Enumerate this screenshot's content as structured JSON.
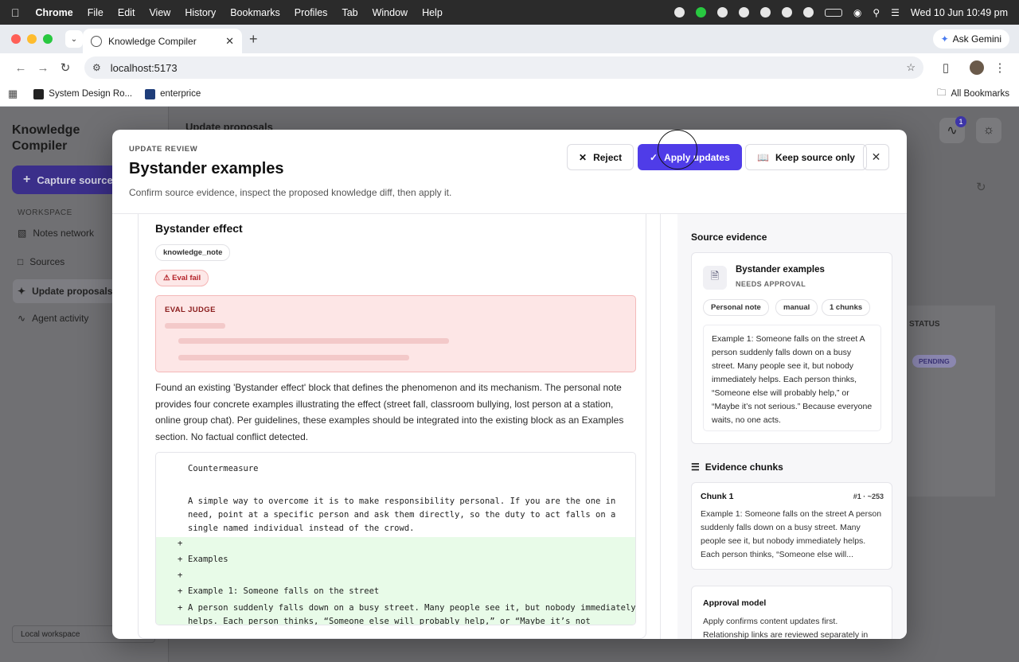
{
  "menubar": {
    "app": "Chrome",
    "items": [
      "File",
      "Edit",
      "View",
      "History",
      "Bookmarks",
      "Profiles",
      "Tab",
      "Window",
      "Help"
    ],
    "datetime": "Wed 10 Jun  10:49 pm"
  },
  "browser": {
    "tab_title": "Knowledge Compiler",
    "url": "localhost:5173",
    "ask_gemini": "Ask Gemini",
    "bookmarks": [
      "System Design Ro...",
      "enterprice"
    ],
    "all_bookmarks": "All Bookmarks"
  },
  "sidebar": {
    "brand": "Knowledge Compiler",
    "capture_button": "Capture source",
    "section_label": "WORKSPACE",
    "items": [
      "Notes network",
      "Sources",
      "Update proposals",
      "Agent activity"
    ],
    "active": "Update proposals",
    "footer": "Local workspace"
  },
  "background": {
    "page_title": "Update proposals",
    "status_header": "STATUS",
    "status_value": "PENDING",
    "activity_badge": "1"
  },
  "modal": {
    "eyebrow": "UPDATE REVIEW",
    "title": "Bystander examples",
    "subtitle": "Confirm source evidence, inspect the proposed knowledge diff, then apply it.",
    "reject": "Reject",
    "apply": "Apply updates",
    "keep_source": "Keep source only",
    "block": {
      "title": "Bystander effect",
      "type": "knowledge_note",
      "eval_status": "Eval fail",
      "eval_heading": "EVAL JUDGE",
      "rationale": "Found an existing 'Bystander effect' block that defines the phenomenon and its mechanism. The personal note provides four concrete examples illustrating the effect (street fall, classroom bullying, lost person at a station, online group chat). Per guidelines, these examples should be integrated into the existing block as an Examples section. No factual conflict detected."
    },
    "diff": [
      {
        "sign": "",
        "text": "Countermeasure"
      },
      {
        "sign": "",
        "text": ""
      },
      {
        "sign": "",
        "text": "A simple way to overcome it is to make responsibility personal. If you are the one in"
      },
      {
        "sign": "",
        "text": "need, point at a specific person and ask them directly, so the duty to act falls on a"
      },
      {
        "sign": "",
        "text": "single named individual instead of the crowd."
      },
      {
        "sign": "+",
        "text": ""
      },
      {
        "sign": "+",
        "text": "Examples"
      },
      {
        "sign": "+",
        "text": ""
      },
      {
        "sign": "+",
        "text": "Example 1: Someone falls on the street"
      },
      {
        "sign": "+",
        "text": "A person suddenly falls down on a busy street. Many people see it, but nobody immediately"
      },
      {
        "sign": "",
        "text": "helps. Each person thinks, “Someone else will probably help,” or “Maybe it’s not serious.”"
      }
    ],
    "source_evidence": {
      "heading": "Source evidence",
      "title": "Bystander examples",
      "status": "NEEDS APPROVAL",
      "pills": [
        "Personal note",
        "manual",
        "1 chunks"
      ],
      "text": "Example 1: Someone falls on the street A person suddenly falls down on a busy street. Many people see it, but nobody immediately helps. Each person thinks, “Someone else will probably help,” or “Maybe it’s not serious.” Because everyone waits, no one acts."
    },
    "chunks": {
      "heading": "Evidence chunks",
      "items": [
        {
          "title": "Chunk 1",
          "meta": "#1 · ~253",
          "text": "Example 1: Someone falls on the street A person suddenly falls down on a busy street. Many people see it, but nobody immediately helps. Each person thinks, “Someone else will..."
        }
      ]
    },
    "approval": {
      "title": "Approval model",
      "text": "Apply confirms content updates first. Relationship links are reviewed separately in"
    }
  },
  "colors": {
    "primary": "#4f3ce8",
    "eval_fail": "#b4232a",
    "diff_add": "#e8fbe8"
  }
}
